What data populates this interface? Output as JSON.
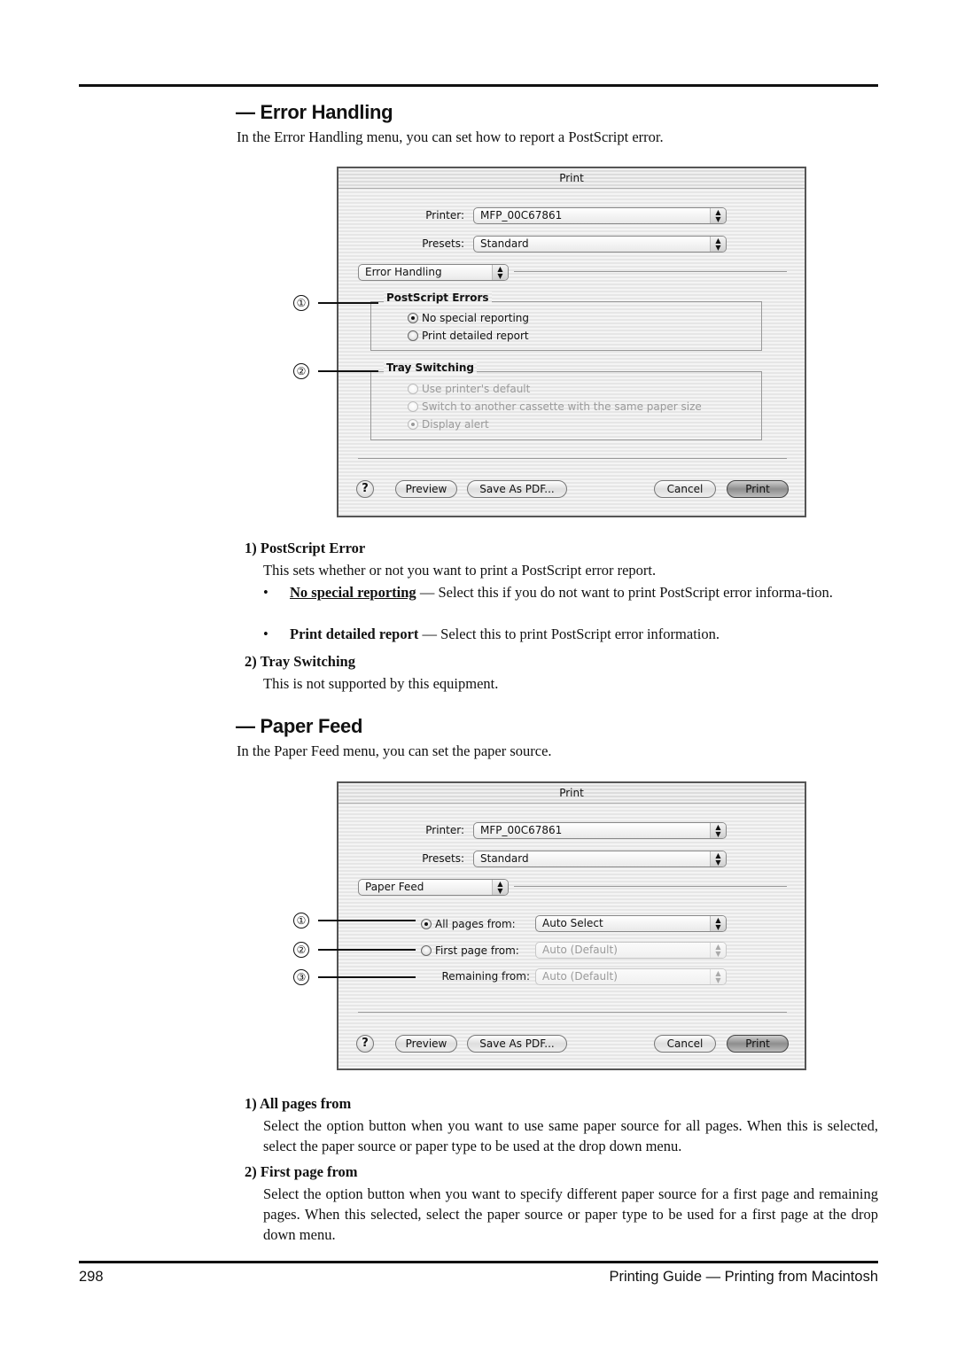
{
  "sections": {
    "error_handling": {
      "title": "— Error Handling",
      "intro": "In the Error Handling menu, you can set how to report a PostScript error.",
      "dialog": {
        "title": "Print",
        "printer_label": "Printer:",
        "printer_value": "MFP_00C67861",
        "presets_label": "Presets:",
        "presets_value": "Standard",
        "panel_value": "Error Handling",
        "postscript_group": {
          "title": "PostScript Errors",
          "options": [
            {
              "label": "No special reporting",
              "selected": true
            },
            {
              "label": "Print detailed report",
              "selected": false
            }
          ]
        },
        "tray_group": {
          "title": "Tray Switching",
          "disabled": true,
          "options": [
            {
              "label": "Use printer's default",
              "selected": false
            },
            {
              "label": "Switch to another cassette with the same paper size",
              "selected": false
            },
            {
              "label": "Display alert",
              "selected": true
            }
          ]
        },
        "buttons": {
          "help": "?",
          "preview": "Preview",
          "save_pdf": "Save As PDF...",
          "cancel": "Cancel",
          "print": "Print"
        },
        "callouts": [
          "①",
          "②"
        ]
      },
      "items": [
        {
          "heading": "1) PostScript Error",
          "text": "This sets whether or not you want to print a PostScript error report.",
          "bullets": [
            {
              "term": "No special reporting",
              "text": " — Select this if you do not want to print PostScript error informa-tion."
            },
            {
              "term": "Print detailed report",
              "text": " — Select this to print PostScript error information."
            }
          ]
        },
        {
          "heading": "2) Tray Switching",
          "text": "This is not supported by this equipment."
        }
      ]
    },
    "paper_feed": {
      "title": "— Paper Feed",
      "intro": "In the Paper Feed menu, you can set the paper source.",
      "dialog": {
        "title": "Print",
        "printer_label": "Printer:",
        "printer_value": "MFP_00C67861",
        "presets_label": "Presets:",
        "presets_value": "Standard",
        "panel_value": "Paper Feed",
        "rows": [
          {
            "label": "All pages from:",
            "value": "Auto Select",
            "selected": true,
            "has_radio": true,
            "disabled": false
          },
          {
            "label": "First page from:",
            "value": "Auto (Default)",
            "selected": false,
            "has_radio": true,
            "disabled": true
          },
          {
            "label": "Remaining from:",
            "value": "Auto (Default)",
            "selected": false,
            "has_radio": false,
            "disabled": true
          }
        ],
        "buttons": {
          "help": "?",
          "preview": "Preview",
          "save_pdf": "Save As PDF...",
          "cancel": "Cancel",
          "print": "Print"
        },
        "callouts": [
          "①",
          "②",
          "③"
        ]
      },
      "items": [
        {
          "heading": "1) All pages from",
          "text": "Select the option button when you want to use same paper source for all pages.  When this is selected, select the paper source or paper type to be used at the drop down menu."
        },
        {
          "heading": "2) First page from",
          "text": "Select the option button when you want to specify different paper source for a first page and remaining pages.  When this selected, select the paper source or paper type to be used for a first page at the drop down menu."
        }
      ]
    }
  },
  "footer": {
    "page_number": "298",
    "title": "Printing Guide — Printing from Macintosh"
  },
  "bullet_glyph": "•",
  "arrows_glyph": "▲▼"
}
